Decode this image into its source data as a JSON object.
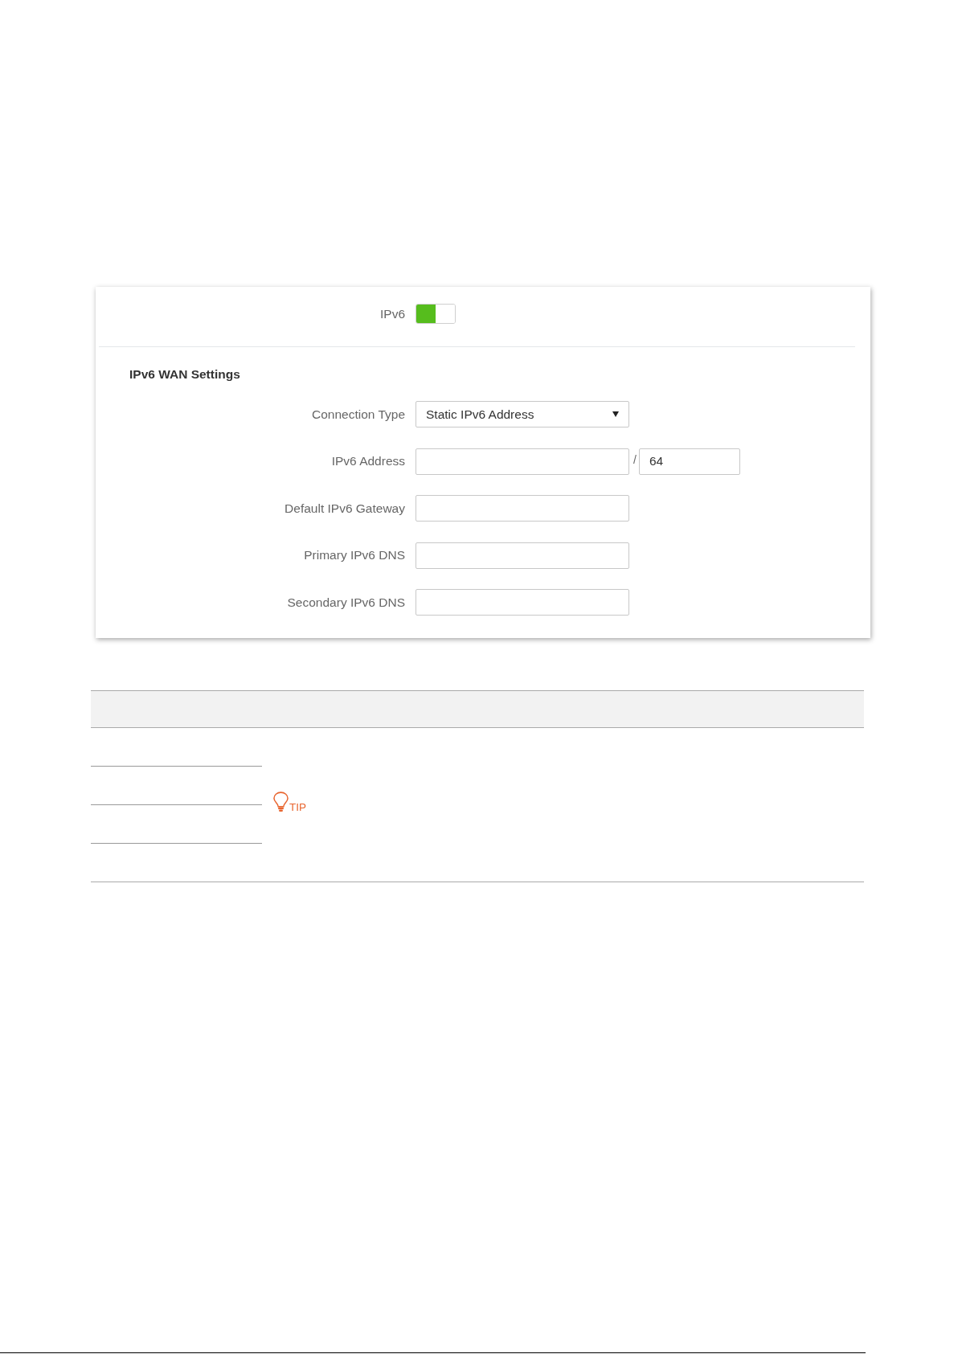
{
  "settings_panel": {
    "ipv6_toggle": {
      "label": "IPv6",
      "on": true
    },
    "section_title": "IPv6 WAN Settings",
    "fields": [
      {
        "kind": "select",
        "label": "Connection Type",
        "value": "Static IPv6 Address"
      },
      {
        "kind": "address_prefix",
        "label": "IPv6 Address",
        "separator": "/",
        "prefix": "64"
      },
      {
        "kind": "text",
        "label": "Default IPv6 Gateway"
      },
      {
        "kind": "text",
        "label": "Primary IPv6 DNS"
      },
      {
        "kind": "text",
        "label": "Secondary IPv6 DNS"
      }
    ]
  },
  "table": {
    "tip": {
      "label": "TIP"
    }
  }
}
